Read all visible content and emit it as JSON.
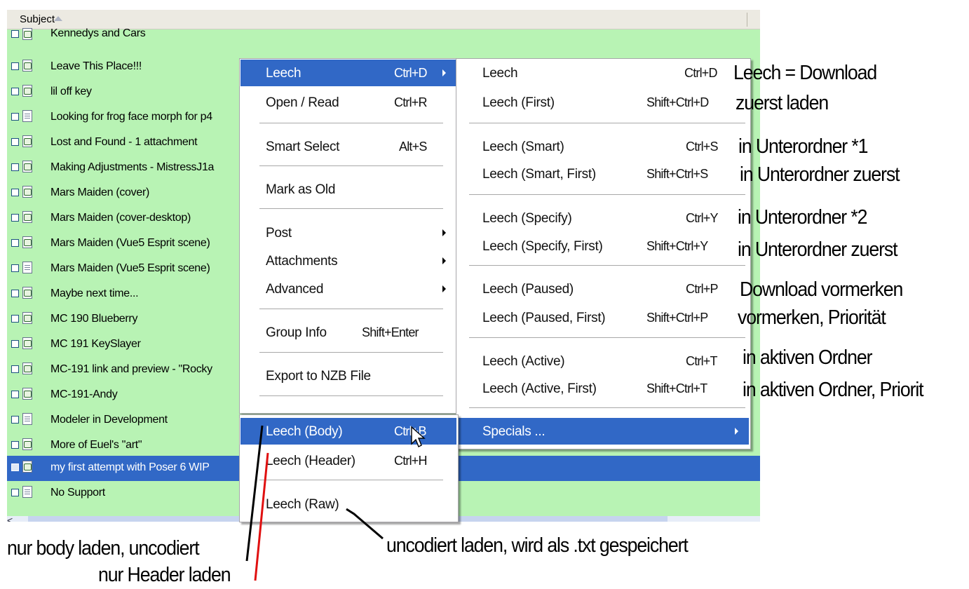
{
  "list": {
    "column_header": "Subject",
    "rows": [
      "Kennedys and Cars",
      "Leave This Place!!!",
      "lil off key",
      "Looking for frog face morph for p4",
      "Lost and Found - 1 attachment",
      "Making Adjustments - MistressJ1a",
      "Mars Maiden (cover)",
      "Mars Maiden (cover-desktop)",
      "Mars Maiden (Vue5 Esprit scene)",
      "Mars Maiden (Vue5 Esprit scene)",
      "Maybe next time...",
      "MC 190 Blueberry",
      "MC 191 KeySlayer",
      "MC-191 link and preview - \"Rocky",
      "MC-191-Andy",
      "Modeler in Development",
      "More of Euel's \"art\"",
      "my first attempt with Poser 6 WIP",
      "No Support"
    ],
    "scroll_left_glyph": "<"
  },
  "main_menu": {
    "leech": {
      "label": "Leech",
      "shortcut": "Ctrl+D"
    },
    "open_read": {
      "label": "Open / Read",
      "shortcut": "Ctrl+R"
    },
    "smart_select": {
      "label": "Smart Select",
      "shortcut": "Alt+S"
    },
    "mark_old": {
      "label": "Mark as Old"
    },
    "post": {
      "label": "Post"
    },
    "attachments": {
      "label": "Attachments"
    },
    "advanced": {
      "label": "Advanced"
    },
    "group_info": {
      "label": "Group Info",
      "shortcut": "Shift+Enter"
    },
    "export_nzb": {
      "label": "Export to NZB File"
    }
  },
  "leech_submenu": {
    "items": [
      {
        "label": "Leech",
        "shortcut": "Ctrl+D"
      },
      {
        "label": "Leech (First)",
        "shortcut": "Shift+Ctrl+D"
      },
      {
        "label": "Leech (Smart)",
        "shortcut": "Ctrl+S"
      },
      {
        "label": "Leech (Smart, First)",
        "shortcut": "Shift+Ctrl+S"
      },
      {
        "label": "Leech (Specify)",
        "shortcut": "Ctrl+Y"
      },
      {
        "label": "Leech (Specify, First)",
        "shortcut": "Shift+Ctrl+Y"
      },
      {
        "label": "Leech (Paused)",
        "shortcut": "Ctrl+P"
      },
      {
        "label": "Leech (Paused, First)",
        "shortcut": "Shift+Ctrl+P"
      },
      {
        "label": "Leech (Active)",
        "shortcut": "Ctrl+T"
      },
      {
        "label": "Leech (Active, First)",
        "shortcut": "Shift+Ctrl+T"
      }
    ],
    "specials": {
      "label": "Specials ..."
    }
  },
  "specials_submenu": {
    "body": {
      "label": "Leech (Body)",
      "shortcut": "Ctrl+B"
    },
    "header": {
      "label": "Leech (Header)",
      "shortcut": "Ctrl+H"
    },
    "raw": {
      "label": "Leech (Raw)"
    }
  },
  "annotations": {
    "right": [
      "Leech = Download",
      "zuerst laden",
      "in Unterordner *1",
      "in Unterordner zuerst",
      "in Unterordner *2",
      "in Unterordner zuerst",
      "Download vormerken",
      "vormerken, Priorität",
      "in aktiven Ordner",
      "in aktiven Ordner, Priorit"
    ],
    "body_note": "nur body laden, uncodiert",
    "header_note": "nur Header laden",
    "raw_note": "uncodiert laden, wird als .txt gespeichert"
  },
  "colors": {
    "list_background": "#b8f3b4",
    "highlight": "#3168c6",
    "header_annotation_line": "#e01010"
  }
}
